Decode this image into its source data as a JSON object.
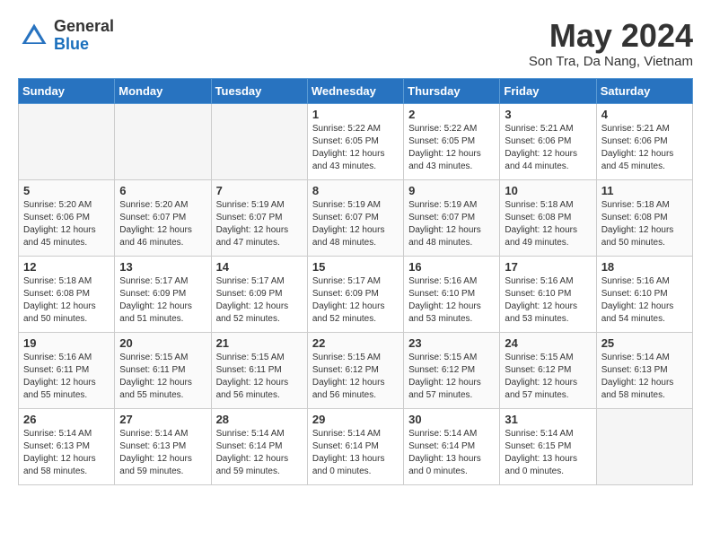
{
  "header": {
    "logo_general": "General",
    "logo_blue": "Blue",
    "month_year": "May 2024",
    "location": "Son Tra, Da Nang, Vietnam"
  },
  "days_of_week": [
    "Sunday",
    "Monday",
    "Tuesday",
    "Wednesday",
    "Thursday",
    "Friday",
    "Saturday"
  ],
  "weeks": [
    [
      {
        "day": "",
        "info": ""
      },
      {
        "day": "",
        "info": ""
      },
      {
        "day": "",
        "info": ""
      },
      {
        "day": "1",
        "info": "Sunrise: 5:22 AM\nSunset: 6:05 PM\nDaylight: 12 hours\nand 43 minutes."
      },
      {
        "day": "2",
        "info": "Sunrise: 5:22 AM\nSunset: 6:05 PM\nDaylight: 12 hours\nand 43 minutes."
      },
      {
        "day": "3",
        "info": "Sunrise: 5:21 AM\nSunset: 6:06 PM\nDaylight: 12 hours\nand 44 minutes."
      },
      {
        "day": "4",
        "info": "Sunrise: 5:21 AM\nSunset: 6:06 PM\nDaylight: 12 hours\nand 45 minutes."
      }
    ],
    [
      {
        "day": "5",
        "info": "Sunrise: 5:20 AM\nSunset: 6:06 PM\nDaylight: 12 hours\nand 45 minutes."
      },
      {
        "day": "6",
        "info": "Sunrise: 5:20 AM\nSunset: 6:07 PM\nDaylight: 12 hours\nand 46 minutes."
      },
      {
        "day": "7",
        "info": "Sunrise: 5:19 AM\nSunset: 6:07 PM\nDaylight: 12 hours\nand 47 minutes."
      },
      {
        "day": "8",
        "info": "Sunrise: 5:19 AM\nSunset: 6:07 PM\nDaylight: 12 hours\nand 48 minutes."
      },
      {
        "day": "9",
        "info": "Sunrise: 5:19 AM\nSunset: 6:07 PM\nDaylight: 12 hours\nand 48 minutes."
      },
      {
        "day": "10",
        "info": "Sunrise: 5:18 AM\nSunset: 6:08 PM\nDaylight: 12 hours\nand 49 minutes."
      },
      {
        "day": "11",
        "info": "Sunrise: 5:18 AM\nSunset: 6:08 PM\nDaylight: 12 hours\nand 50 minutes."
      }
    ],
    [
      {
        "day": "12",
        "info": "Sunrise: 5:18 AM\nSunset: 6:08 PM\nDaylight: 12 hours\nand 50 minutes."
      },
      {
        "day": "13",
        "info": "Sunrise: 5:17 AM\nSunset: 6:09 PM\nDaylight: 12 hours\nand 51 minutes."
      },
      {
        "day": "14",
        "info": "Sunrise: 5:17 AM\nSunset: 6:09 PM\nDaylight: 12 hours\nand 52 minutes."
      },
      {
        "day": "15",
        "info": "Sunrise: 5:17 AM\nSunset: 6:09 PM\nDaylight: 12 hours\nand 52 minutes."
      },
      {
        "day": "16",
        "info": "Sunrise: 5:16 AM\nSunset: 6:10 PM\nDaylight: 12 hours\nand 53 minutes."
      },
      {
        "day": "17",
        "info": "Sunrise: 5:16 AM\nSunset: 6:10 PM\nDaylight: 12 hours\nand 53 minutes."
      },
      {
        "day": "18",
        "info": "Sunrise: 5:16 AM\nSunset: 6:10 PM\nDaylight: 12 hours\nand 54 minutes."
      }
    ],
    [
      {
        "day": "19",
        "info": "Sunrise: 5:16 AM\nSunset: 6:11 PM\nDaylight: 12 hours\nand 55 minutes."
      },
      {
        "day": "20",
        "info": "Sunrise: 5:15 AM\nSunset: 6:11 PM\nDaylight: 12 hours\nand 55 minutes."
      },
      {
        "day": "21",
        "info": "Sunrise: 5:15 AM\nSunset: 6:11 PM\nDaylight: 12 hours\nand 56 minutes."
      },
      {
        "day": "22",
        "info": "Sunrise: 5:15 AM\nSunset: 6:12 PM\nDaylight: 12 hours\nand 56 minutes."
      },
      {
        "day": "23",
        "info": "Sunrise: 5:15 AM\nSunset: 6:12 PM\nDaylight: 12 hours\nand 57 minutes."
      },
      {
        "day": "24",
        "info": "Sunrise: 5:15 AM\nSunset: 6:12 PM\nDaylight: 12 hours\nand 57 minutes."
      },
      {
        "day": "25",
        "info": "Sunrise: 5:14 AM\nSunset: 6:13 PM\nDaylight: 12 hours\nand 58 minutes."
      }
    ],
    [
      {
        "day": "26",
        "info": "Sunrise: 5:14 AM\nSunset: 6:13 PM\nDaylight: 12 hours\nand 58 minutes."
      },
      {
        "day": "27",
        "info": "Sunrise: 5:14 AM\nSunset: 6:13 PM\nDaylight: 12 hours\nand 59 minutes."
      },
      {
        "day": "28",
        "info": "Sunrise: 5:14 AM\nSunset: 6:14 PM\nDaylight: 12 hours\nand 59 minutes."
      },
      {
        "day": "29",
        "info": "Sunrise: 5:14 AM\nSunset: 6:14 PM\nDaylight: 13 hours\nand 0 minutes."
      },
      {
        "day": "30",
        "info": "Sunrise: 5:14 AM\nSunset: 6:14 PM\nDaylight: 13 hours\nand 0 minutes."
      },
      {
        "day": "31",
        "info": "Sunrise: 5:14 AM\nSunset: 6:15 PM\nDaylight: 13 hours\nand 0 minutes."
      },
      {
        "day": "",
        "info": ""
      }
    ]
  ]
}
